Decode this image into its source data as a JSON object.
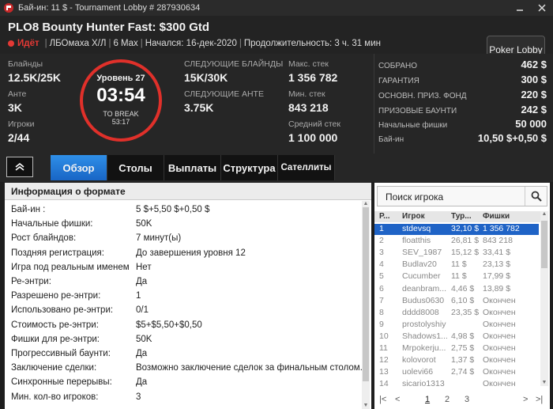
{
  "window": {
    "title": "Бай-ин: 11 $ - Tournament Lobby # 287930634"
  },
  "header": {
    "tournament_name": "PLO8 Bounty Hunter Fast: $300 Gtd",
    "status": "Идёт",
    "meta": [
      "ЛБОмаха Х/Л",
      "6 Max",
      "Начался: 16-дек-2020",
      "Продолжительность: 3 ч. 31 мин"
    ],
    "lobby_button": "Poker Lobby"
  },
  "stats": {
    "blinds_label": "Блайнды",
    "blinds_value": "12.5K/25K",
    "ante_label": "Анте",
    "ante_value": "3K",
    "players_label": "Игроки",
    "players_value": "2/44",
    "level": "Уровень 27",
    "clock": "03:54",
    "to_break_label": "TO BREAK",
    "to_break_time": "53:17",
    "next_blinds_label": "СЛЕДУЮЩИЕ БЛАЙНДЫ",
    "next_blinds_value": "15K/30K",
    "next_ante_label": "СЛЕДУЮЩИЕ АНТЕ",
    "next_ante_value": "3.75K",
    "max_stack_label": "Макс. стек",
    "max_stack_value": "1 356 782",
    "min_stack_label": "Мин. стек",
    "min_stack_value": "843 218",
    "avg_stack_label": "Средний стек",
    "avg_stack_value": "1 100 000"
  },
  "prize": [
    {
      "label": "СОБРАНО",
      "value": "462 $"
    },
    {
      "label": "ГАРАНТИЯ",
      "value": "300 $"
    },
    {
      "label": "ОСНОВН. ПРИЗ. ФОНД",
      "value": "220 $"
    },
    {
      "label": "ПРИЗОВЫЕ БАУНТИ",
      "value": "242 $"
    },
    {
      "label": "Начальные фишки",
      "value": "50 000"
    },
    {
      "label": "Бай-ин",
      "value": "10,50 $+0,50 $"
    }
  ],
  "tabs": [
    "Обзор",
    "Столы",
    "Выплаты",
    "Структура",
    "Сателлиты"
  ],
  "format": {
    "title": "Информация о формате",
    "rows": [
      {
        "label": "Бай-ин :",
        "value": "5 $+5,50 $+0,50 $"
      },
      {
        "label": "Начальные фишки:",
        "value": "50K"
      },
      {
        "label": "Рост блайндов:",
        "value": "7 минут(ы)"
      },
      {
        "label": "Поздняя регистрация:",
        "value": "До завершения уровня 12"
      },
      {
        "label": "Игра под реальным именем",
        "value": "Нет"
      },
      {
        "label": "Ре-энтри:",
        "value": "Да"
      },
      {
        "label": "Разрешено ре-энтри:",
        "value": "1"
      },
      {
        "label": "Использовано ре-энтри:",
        "value": "0/1"
      },
      {
        "label": "Стоимость ре-энтри:",
        "value": "$5+$5,50+$0,50"
      },
      {
        "label": "Фишки для ре-энтри:",
        "value": "50K"
      },
      {
        "label": "Прогрессивный баунти:",
        "value": "Да"
      },
      {
        "label": "Заключение сделки:",
        "value": "Возможно заключение сделок за финальным столом."
      },
      {
        "label": "Синхронные перерывы:",
        "value": "Да"
      },
      {
        "label": "Мин. кол-во игроков:",
        "value": "3"
      }
    ]
  },
  "players": {
    "search_placeholder": "Поиск игрока",
    "columns": [
      "Р...",
      "Игрок",
      "Тур...",
      "Фишки"
    ],
    "rows": [
      {
        "rank": "1",
        "name": "stdevsq",
        "prize": "32,10 $",
        "chips": "1 356 782"
      },
      {
        "rank": "2",
        "name": "floatthis",
        "prize": "26,81 $",
        "chips": "843 218"
      },
      {
        "rank": "3",
        "name": "SEV_1987",
        "prize": "15,12 $",
        "chips": "33,41 $"
      },
      {
        "rank": "4",
        "name": "Budlav20",
        "prize": "11 $",
        "chips": "23,13 $"
      },
      {
        "rank": "5",
        "name": "Cucumber",
        "prize": "11 $",
        "chips": "17,99 $"
      },
      {
        "rank": "6",
        "name": "deanbram...",
        "prize": "4,46 $",
        "chips": "13,89 $"
      },
      {
        "rank": "7",
        "name": "Budus0630",
        "prize": "6,10 $",
        "chips": "Окончен"
      },
      {
        "rank": "8",
        "name": "dddd8008",
        "prize": "23,35 $",
        "chips": "Окончен"
      },
      {
        "rank": "9",
        "name": "prostolyshiy",
        "prize": "",
        "chips": "Окончен"
      },
      {
        "rank": "10",
        "name": "Shadows1...",
        "prize": "4,98 $",
        "chips": "Окончен"
      },
      {
        "rank": "11",
        "name": "Mrpokerju...",
        "prize": "2,75 $",
        "chips": "Окончен"
      },
      {
        "rank": "12",
        "name": "kolovorot",
        "prize": "1,37 $",
        "chips": "Окончен"
      },
      {
        "rank": "13",
        "name": "uolevi66",
        "prize": "2,74 $",
        "chips": "Окончен"
      },
      {
        "rank": "14",
        "name": "sicario1313",
        "prize": "",
        "chips": "Окончен"
      }
    ],
    "pages": [
      "1",
      "2",
      "3"
    ]
  }
}
